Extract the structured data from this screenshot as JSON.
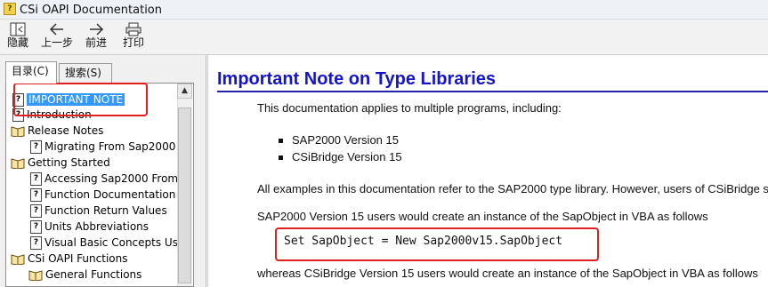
{
  "window": {
    "title": "CSi OAPI Documentation"
  },
  "toolbar": {
    "hide": "隐藏",
    "back": "上一步",
    "forward": "前进",
    "print": "打印"
  },
  "tabs": {
    "contents": "目录(C)",
    "search": "搜索(S)"
  },
  "tree": [
    {
      "label": "IMPORTANT NOTE",
      "icon": "help-page-icon"
    },
    {
      "label": "Introduction",
      "icon": "help-page-icon"
    },
    {
      "label": "Release Notes",
      "icon": "open-book-icon"
    },
    {
      "label": "Migrating From Sap2000 v1",
      "icon": "help-page-icon"
    },
    {
      "label": "Getting Started",
      "icon": "open-book-icon"
    },
    {
      "label": "Accessing Sap2000 From",
      "icon": "help-page-icon"
    },
    {
      "label": "Function Documentation C",
      "icon": "help-page-icon"
    },
    {
      "label": "Function Return Values",
      "icon": "help-page-icon"
    },
    {
      "label": "Units Abbreviations",
      "icon": "help-page-icon"
    },
    {
      "label": "Visual Basic Concepts Us",
      "icon": "help-page-icon"
    },
    {
      "label": "CSi OAPI Functions",
      "icon": "open-book-icon"
    },
    {
      "label": "General Functions",
      "icon": "open-book-icon"
    }
  ],
  "content": {
    "heading": "Important Note on Type Libraries",
    "p1": "This documentation applies to multiple programs, including:",
    "bullets": [
      "SAP2000 Version 15",
      "CSiBridge Version 15"
    ],
    "p2": "All examples in this documentation refer to the SAP2000 type library. However, users of CSiBridge s",
    "p3": "SAP2000 Version 15 users would create an instance of the SapObject in VBA as follows",
    "code": "Set SapObject = New Sap2000v15.SapObject",
    "p4": "whereas CSiBridge Version 15 users would create an instance of the SapObject in VBA as follows"
  },
  "colors": {
    "heading": "#1414cc",
    "annotation": "#e02020",
    "selection": "#3399ff"
  }
}
